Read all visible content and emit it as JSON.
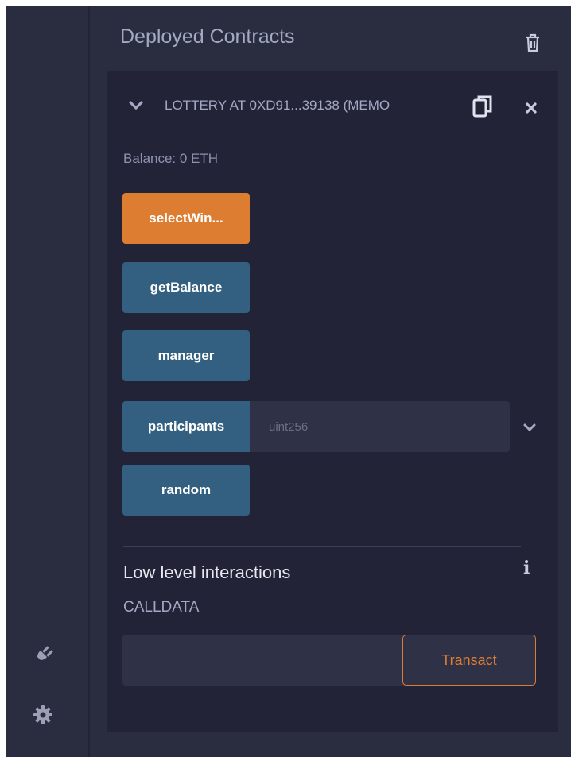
{
  "panel": {
    "title": "Deployed Contracts"
  },
  "instance": {
    "name": "LOTTERY AT 0XD91...39138 (MEMO",
    "balance": "Balance: 0 ETH"
  },
  "functions": [
    {
      "label": "selectWin...",
      "kind": "payable"
    },
    {
      "label": "getBalance",
      "kind": "view"
    },
    {
      "label": "manager",
      "kind": "view"
    },
    {
      "label": "participants",
      "kind": "view",
      "input_placeholder": "uint256"
    },
    {
      "label": "random",
      "kind": "view"
    }
  ],
  "low_level": {
    "title": "Low level interactions",
    "calldata_label": "CALLDATA",
    "calldata_value": "",
    "transact_label": "Transact"
  },
  "icons": {
    "trash": "trash-icon",
    "chevron": "chevron-down-icon",
    "copy": "copy-icon",
    "close": "close-icon",
    "info": "info-icon",
    "plugin": "plug-icon",
    "settings": "gear-icon"
  },
  "colors": {
    "background": "#222336",
    "panel": "#2a2c3f",
    "payable_button": "#dc7d31",
    "view_button": "#336080",
    "text": "#a3a8c3"
  }
}
